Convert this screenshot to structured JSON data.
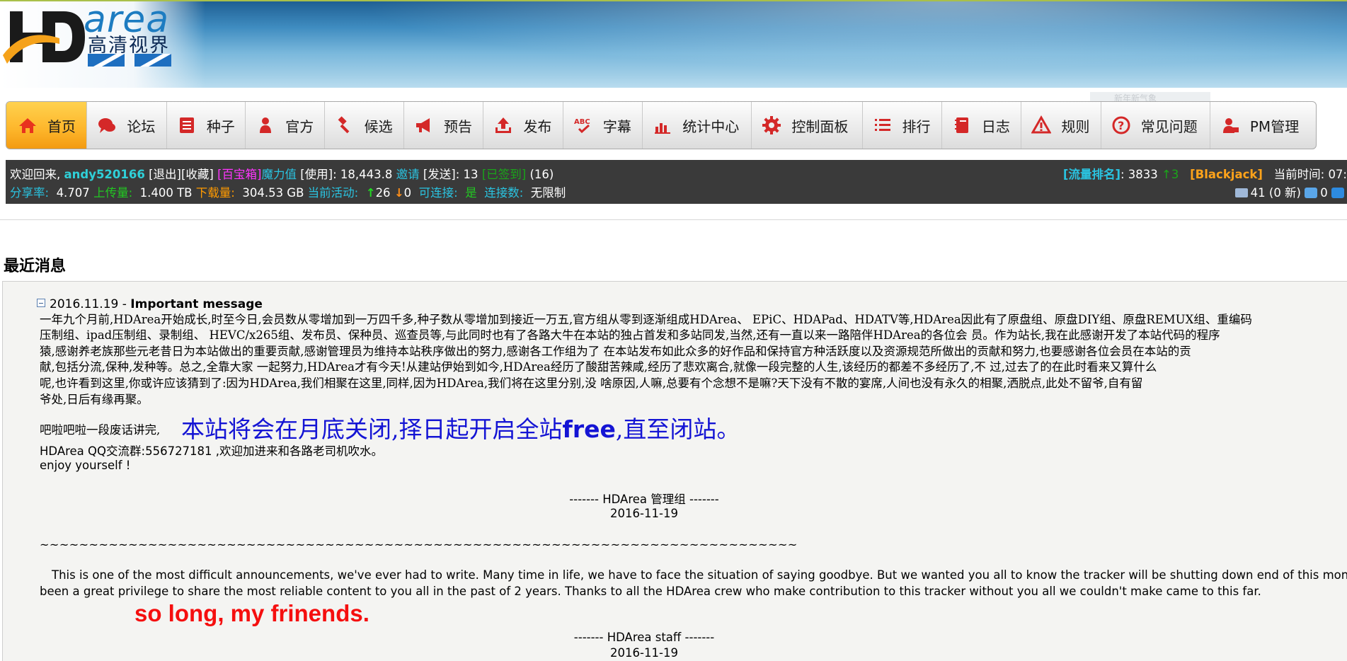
{
  "header": {
    "logo_hd": "HD",
    "logo_area": "area",
    "logo_cn": "高清视界",
    "hidden_tag": "新年新气象"
  },
  "nav": {
    "items": [
      {
        "label": "首页",
        "icon": "home-icon",
        "active": true
      },
      {
        "label": "论坛",
        "icon": "chat-bubble-icon"
      },
      {
        "label": "种子",
        "icon": "list-icon"
      },
      {
        "label": "官方",
        "icon": "person-icon"
      },
      {
        "label": "候选",
        "icon": "gavel-icon"
      },
      {
        "label": "预告",
        "icon": "megaphone-icon"
      },
      {
        "label": "发布",
        "icon": "upload-icon"
      },
      {
        "label": "字幕",
        "icon": "spellcheck-icon"
      },
      {
        "label": "统计中心",
        "icon": "bar-chart-icon"
      },
      {
        "label": "控制面板",
        "icon": "gear-icon"
      },
      {
        "label": "排行",
        "icon": "ranked-list-icon"
      },
      {
        "label": "日志",
        "icon": "notebook-icon"
      },
      {
        "label": "规则",
        "icon": "warning-icon"
      },
      {
        "label": "常见问题",
        "icon": "question-icon"
      },
      {
        "label": "PM管理",
        "icon": "pm-user-icon"
      }
    ]
  },
  "userbar": {
    "welcome": "欢迎回来,",
    "username": "andy520166",
    "logout": "[退出]",
    "favorites": "[收藏]",
    "treasure": "[百宝箱]",
    "magic_label": "魔力值",
    "use": "[使用]",
    "magic_value": ": 18,443.8",
    "invite": "邀请",
    "send": "[发送]",
    "invite_count": ": 13",
    "signed": "[已签到]",
    "signed_count": "(16)",
    "ratio_label": "分享率:",
    "ratio": "4.707",
    "upload_label": "上传量:",
    "upload": "1.400 TB",
    "download_label": "下载量:",
    "download": "304.53 GB",
    "activity_label": "当前活动:",
    "seeding": "26",
    "leeching": "0",
    "connectable_label": "可连接:",
    "connectable": "是",
    "connections_label": "连接数:",
    "connections": "无限制",
    "traffic_rank_label": "[流量排名]",
    "traffic_rank": ": 3833",
    "rank_change": "↑3",
    "blackjack": "[Blackjack]",
    "time_label": "当前时间:",
    "time": "07:",
    "mail_count": "41 (0 新)",
    "message_count": "0"
  },
  "news": {
    "section_title": "最近消息",
    "date": "2016.11.19",
    "sep": " - ",
    "headline": "Important message",
    "paragraph_lines": [
      "一年九个月前,HDArea开始成长,时至今日,会员数从零增加到一万四千多,种子数从零增加到接近一万五,官方组从零到逐渐组成HDArea、 EPiC、HDAPad、HDATV等,HDArea因此有了原盘组、原盘DIY组、原盘REMUX组、重编码",
      "压制组、ipad压制组、录制组、 HEVC/x265组、发布员、保种员、巡查员等,与此同时也有了各路大牛在本站的独占首发和多站同发,当然,还有一直以来一路陪伴HDArea的各位会 员。作为站长,我在此感谢开发了本站代码的程序",
      "猿,感谢养老族那些元老昔日为本站做出的重要贡献,感谢管理员为维持本站秩序做出的努力,感谢各工作组为了 在本站发布如此众多的好作品和保持官方种活跃度以及资源规范所做出的贡献和努力,也要感谢各位会员在本站的贡",
      "献,包括分流,保种,发种等。总之,全靠大家 一起努力,HDArea才有今天!从建站伊始到如今,HDArea经历了酸甜苦辣咸,经历了悲欢离合,就像一段完整的人生,该经历的都差不多经历了,不 过,过去了的在此时看来又算什么",
      "呢,也许看到这里,你或许应该猜到了:因为HDArea,我们相聚在这里,同样,因为HDArea,我们将在这里分别,没 啥原因,人嘛,总要有个念想不是嘛?天下没有不散的宴席,人间也没有永久的相聚,洒脱点,此处不留爷,自有留",
      "爷处,日后有缘再聚。"
    ],
    "nonsense": "吧啦吧啦一段废话讲完,",
    "big_pre": "本站将会在月底关闭,择日起开启全站",
    "big_free": "free",
    "big_post": ",直至闭站。",
    "qq_line": "HDArea QQ交流群:556727181 ,欢迎加进来和各路老司机吹水。",
    "enjoy": "enjoy yourself !",
    "sign_cn": "-------  HDArea 管理组   -------",
    "sign_cn_date": "2016-11-19",
    "tilde": "~~~~~~~~~~~~~~~~~~~~~~~~~~~~~~~~~~~~~~~~~~~~~~~~~~~~~~~~~~~~~~~~~~~~~~~~~~~~~",
    "en_line1": "This is one of the most difficult announcements, we've ever had to write. Many time in life, we have to face the situation of saying goodbye. But we wanted you all to know the tracker will be shutting down end of this month. It ha",
    "en_line2": "been a great privilege to share the most reliable content to you all in the past of 2 years. Thanks to all the HDArea crew who make contribution to this tracker without you all we couldn't make came to this far.",
    "red_line": "so long, my frinends.",
    "sign_en": "-------  HDArea staff   -------",
    "sign_en_date": "2016-11-19"
  },
  "colors": {
    "nav_active": "#fdb52a",
    "infobar_bg": "#3a3a3a",
    "username": "#2fd0d8",
    "big_blue": "#1414d4",
    "red": "#f50f0f"
  }
}
